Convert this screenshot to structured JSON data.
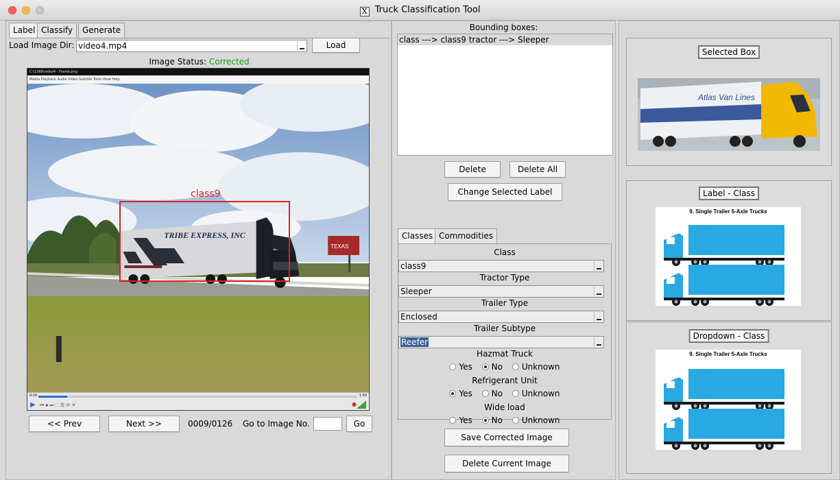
{
  "window": {
    "title": "Truck Classification Tool",
    "x_icon": "X"
  },
  "left_tabs": [
    "Label",
    "Classify",
    "Generate"
  ],
  "load": {
    "label": "Load Image Dir:",
    "value": "video4.mp4",
    "button": "Load"
  },
  "status": {
    "label": "Image Status:",
    "value": "Corrected"
  },
  "player": {
    "title": "C:\\1368\\video4 - Frame.png",
    "menu": "Media  Playback  Audio  Video  Subtitle  Tools  View  Help",
    "time_left": "0:10",
    "time_right": "1:50",
    "progress": 0.09
  },
  "annotation": {
    "label": "class9",
    "trailer_text": "TRIBE EXPRESS, INC",
    "billboard_text": "TEXAS"
  },
  "nav": {
    "prev": "<< Prev",
    "next": "Next >>",
    "counter": "0009/0126",
    "goto_label": "Go to Image No.",
    "go": "Go"
  },
  "bounding": {
    "title": "Bounding boxes:",
    "items": [
      "class ---> class9    tractor ---> Sleeper"
    ],
    "delete": "Delete",
    "delete_all": "Delete All",
    "change_label": "Change Selected Label"
  },
  "class_tabs": [
    "Classes",
    "Commodities"
  ],
  "form": {
    "class_label": "Class",
    "class_value": "class9",
    "tractor_label": "Tractor Type",
    "tractor_value": "Sleeper",
    "trailer_label": "Trailer Type",
    "trailer_value": "Enclosed",
    "subtype_label": "Trailer Subtype",
    "subtype_value": "Reefer",
    "hazmat_label": "Hazmat Truck",
    "refrigerant_label": "Refrigerant Unit",
    "wide_label": "Wide load",
    "options": [
      "Yes",
      "No",
      "Unknown"
    ],
    "hazmat_selected": "No",
    "refrigerant_selected": "Yes",
    "wide_selected": "No"
  },
  "actions": {
    "save": "Save Corrected Image",
    "delete_current": "Delete Current Image"
  },
  "right": {
    "selected_box": "Selected Box",
    "selected_texts": [
      "Atlas Van Lines"
    ],
    "label_class": "Label - Class",
    "dropdown_class": "Dropdown - Class",
    "diagram_title": "9. Single Trailer 5-Axle Trucks"
  },
  "colors": {
    "status_green": "#1a9a1a",
    "bbox_red": "#e02020",
    "diagram_blue": "#29a9e1",
    "selection": "#3b5f9a"
  }
}
